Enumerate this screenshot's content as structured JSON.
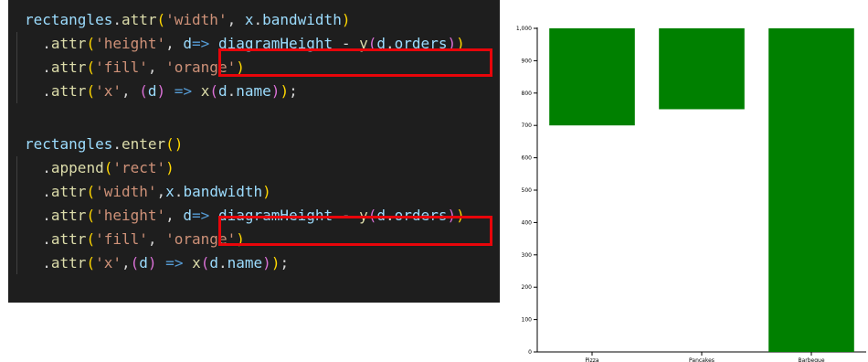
{
  "code": {
    "lines": [
      [
        {
          "t": "rectangles",
          "c": "var"
        },
        {
          "t": ".",
          "c": "punc"
        },
        {
          "t": "attr",
          "c": "fn"
        },
        {
          "t": "(",
          "c": "br1"
        },
        {
          "t": "'width'",
          "c": "str"
        },
        {
          "t": ", ",
          "c": "punc"
        },
        {
          "t": "x",
          "c": "var"
        },
        {
          "t": ".",
          "c": "punc"
        },
        {
          "t": "bandwidth",
          "c": "var"
        },
        {
          "t": ")",
          "c": "br1"
        }
      ],
      [
        {
          "t": "  .",
          "c": "punc"
        },
        {
          "t": "attr",
          "c": "fn"
        },
        {
          "t": "(",
          "c": "br1"
        },
        {
          "t": "'height'",
          "c": "str"
        },
        {
          "t": ", ",
          "c": "punc"
        },
        {
          "t": "d",
          "c": "var"
        },
        {
          "t": "=>",
          "c": "kw"
        },
        {
          "t": " ",
          "c": "punc"
        },
        {
          "t": "diagramHeight",
          "c": "var"
        },
        {
          "t": " - ",
          "c": "punc"
        },
        {
          "t": "y",
          "c": "fn"
        },
        {
          "t": "(",
          "c": "br2"
        },
        {
          "t": "d",
          "c": "var"
        },
        {
          "t": ".",
          "c": "punc"
        },
        {
          "t": "orders",
          "c": "var"
        },
        {
          "t": ")",
          "c": "br2"
        },
        {
          "t": ")",
          "c": "br1"
        }
      ],
      [
        {
          "t": "  .",
          "c": "punc"
        },
        {
          "t": "attr",
          "c": "fn"
        },
        {
          "t": "(",
          "c": "br1"
        },
        {
          "t": "'fill'",
          "c": "str"
        },
        {
          "t": ", ",
          "c": "punc"
        },
        {
          "t": "'orange'",
          "c": "str"
        },
        {
          "t": ")",
          "c": "br1"
        }
      ],
      [
        {
          "t": "  .",
          "c": "punc"
        },
        {
          "t": "attr",
          "c": "fn"
        },
        {
          "t": "(",
          "c": "br1"
        },
        {
          "t": "'x'",
          "c": "str"
        },
        {
          "t": ", ",
          "c": "punc"
        },
        {
          "t": "(",
          "c": "br2"
        },
        {
          "t": "d",
          "c": "var"
        },
        {
          "t": ")",
          "c": "br2"
        },
        {
          "t": " => ",
          "c": "kw"
        },
        {
          "t": "x",
          "c": "fn"
        },
        {
          "t": "(",
          "c": "br2"
        },
        {
          "t": "d",
          "c": "var"
        },
        {
          "t": ".",
          "c": "punc"
        },
        {
          "t": "name",
          "c": "var"
        },
        {
          "t": ")",
          "c": "br2"
        },
        {
          "t": ")",
          "c": "br1"
        },
        {
          "t": ";",
          "c": "punc"
        }
      ],
      [],
      [
        {
          "t": "rectangles",
          "c": "var"
        },
        {
          "t": ".",
          "c": "punc"
        },
        {
          "t": "enter",
          "c": "fn"
        },
        {
          "t": "()",
          "c": "br1"
        }
      ],
      [
        {
          "t": "  .",
          "c": "punc"
        },
        {
          "t": "append",
          "c": "fn"
        },
        {
          "t": "(",
          "c": "br1"
        },
        {
          "t": "'rect'",
          "c": "str"
        },
        {
          "t": ")",
          "c": "br1"
        }
      ],
      [
        {
          "t": "  .",
          "c": "punc"
        },
        {
          "t": "attr",
          "c": "fn"
        },
        {
          "t": "(",
          "c": "br1"
        },
        {
          "t": "'width'",
          "c": "str"
        },
        {
          "t": ",",
          "c": "punc"
        },
        {
          "t": "x",
          "c": "var"
        },
        {
          "t": ".",
          "c": "punc"
        },
        {
          "t": "bandwidth",
          "c": "var"
        },
        {
          "t": ")",
          "c": "br1"
        }
      ],
      [
        {
          "t": "  .",
          "c": "punc"
        },
        {
          "t": "attr",
          "c": "fn"
        },
        {
          "t": "(",
          "c": "br1"
        },
        {
          "t": "'height'",
          "c": "str"
        },
        {
          "t": ", ",
          "c": "punc"
        },
        {
          "t": "d",
          "c": "var"
        },
        {
          "t": "=>",
          "c": "kw"
        },
        {
          "t": " ",
          "c": "punc"
        },
        {
          "t": "diagramHeight",
          "c": "var"
        },
        {
          "t": " - ",
          "c": "punc"
        },
        {
          "t": "y",
          "c": "fn"
        },
        {
          "t": "(",
          "c": "br2"
        },
        {
          "t": "d",
          "c": "var"
        },
        {
          "t": ".",
          "c": "punc"
        },
        {
          "t": "orders",
          "c": "var"
        },
        {
          "t": ")",
          "c": "br2"
        },
        {
          "t": ")",
          "c": "br1"
        }
      ],
      [
        {
          "t": "  .",
          "c": "punc"
        },
        {
          "t": "attr",
          "c": "fn"
        },
        {
          "t": "(",
          "c": "br1"
        },
        {
          "t": "'fill'",
          "c": "str"
        },
        {
          "t": ", ",
          "c": "punc"
        },
        {
          "t": "'orange'",
          "c": "str"
        },
        {
          "t": ")",
          "c": "br1"
        }
      ],
      [
        {
          "t": "  .",
          "c": "punc"
        },
        {
          "t": "attr",
          "c": "fn"
        },
        {
          "t": "(",
          "c": "br1"
        },
        {
          "t": "'x'",
          "c": "str"
        },
        {
          "t": ",",
          "c": "punc"
        },
        {
          "t": "(",
          "c": "br2"
        },
        {
          "t": "d",
          "c": "var"
        },
        {
          "t": ")",
          "c": "br2"
        },
        {
          "t": " => ",
          "c": "kw"
        },
        {
          "t": "x",
          "c": "fn"
        },
        {
          "t": "(",
          "c": "br2"
        },
        {
          "t": "d",
          "c": "var"
        },
        {
          "t": ".",
          "c": "punc"
        },
        {
          "t": "name",
          "c": "var"
        },
        {
          "t": ")",
          "c": "br2"
        },
        {
          "t": ")",
          "c": "br1"
        },
        {
          "t": ";",
          "c": "punc"
        }
      ]
    ]
  },
  "colors": {
    "editor_bg": "#1e1e1e",
    "highlight_box": "#e8050a",
    "bar_fill": "#008000"
  },
  "chart_data": {
    "type": "bar",
    "categories": [
      "Pizza",
      "Pancakes",
      "Barbeque"
    ],
    "bar_ranges": [
      {
        "category": "Pizza",
        "from": 700,
        "to": 1000
      },
      {
        "category": "Pancakes",
        "from": 750,
        "to": 1000
      },
      {
        "category": "Barbeque",
        "from": 0,
        "to": 1000
      }
    ],
    "ylim": [
      0,
      1000
    ],
    "yticks": [
      0,
      100,
      200,
      300,
      400,
      500,
      600,
      700,
      800,
      900,
      1000
    ],
    "ytick_labels": [
      "0",
      "100",
      "200",
      "300",
      "400",
      "500",
      "600",
      "700",
      "800",
      "900",
      "1,000"
    ],
    "grid": false,
    "title": "",
    "xlabel": "",
    "ylabel": ""
  }
}
